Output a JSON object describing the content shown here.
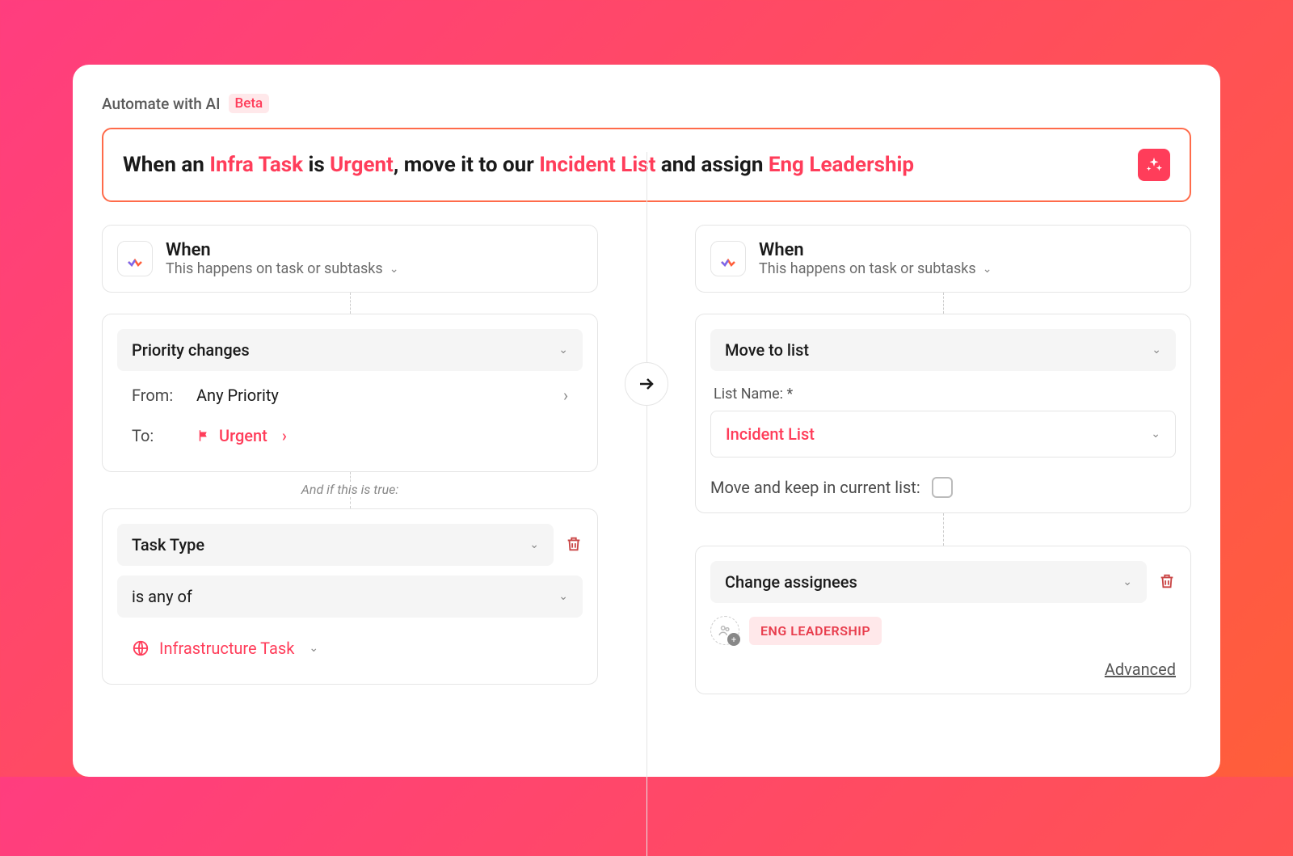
{
  "header": {
    "title": "Automate with AI",
    "badge": "Beta"
  },
  "prompt": {
    "pre1": "When an ",
    "h1": "Infra Task",
    "pre2": " is ",
    "h2": "Urgent",
    "pre3": ", move it to our ",
    "h3": "Incident List",
    "pre4": " and assign ",
    "h4": "Eng Leadership"
  },
  "left": {
    "when": {
      "title": "When",
      "sub": "This happens on task or subtasks"
    },
    "trigger": {
      "select": "Priority changes",
      "from_label": "From:",
      "from_value": "Any Priority",
      "to_label": "To:",
      "to_value": "Urgent"
    },
    "cond_label": "And if this is true:",
    "condition": {
      "field": "Task Type",
      "op": "is any of",
      "value": "Infrastructure Task"
    }
  },
  "right": {
    "when": {
      "title": "When",
      "sub": "This happens on task or subtasks"
    },
    "action1": {
      "select": "Move to list",
      "list_label": "List Name: *",
      "list_value": "Incident List",
      "keep_label": "Move and keep in current list:"
    },
    "action2": {
      "select": "Change assignees",
      "chip": "ENG LEADERSHIP",
      "advanced": "Advanced"
    }
  }
}
